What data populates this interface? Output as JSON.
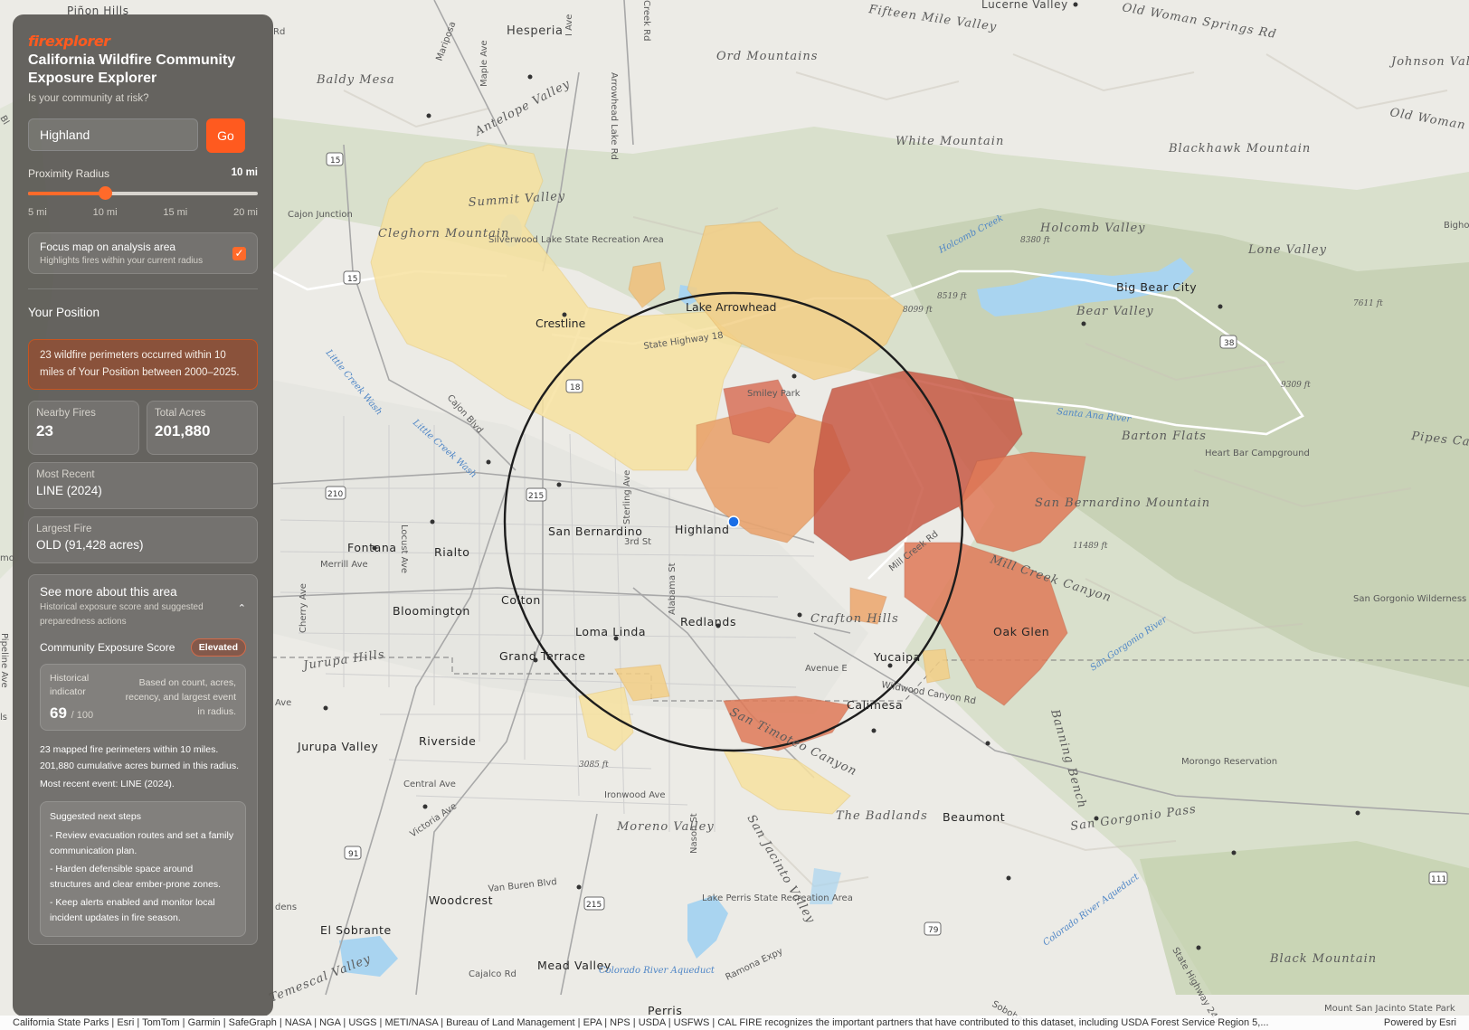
{
  "panel": {
    "logo": "firexplorer",
    "title": "California Wildfire Community Exposure Explorer",
    "subtitle": "Is your community at risk?",
    "search": {
      "value": "Highland",
      "go_label": "Go"
    },
    "radius": {
      "label": "Proximity Radius",
      "value_label": "10 mi",
      "value": 10,
      "min": 5,
      "max": 20,
      "ticks": [
        "5 mi",
        "10 mi",
        "15 mi",
        "20 mi"
      ]
    },
    "focus": {
      "label": "Focus map on analysis area",
      "hint": "Highlights fires within your current radius",
      "checked": true
    },
    "position_title": "Your Position",
    "alert": "23 wildfire perimeters occurred within 10 miles of Your Position between 2000–2025.",
    "nearby": {
      "label": "Nearby Fires",
      "value": "23"
    },
    "acres": {
      "label": "Total Acres",
      "value": "201,880"
    },
    "recent": {
      "label": "Most Recent",
      "value": "LINE (2024)"
    },
    "largest": {
      "label": "Largest Fire",
      "value": "OLD (91,428 acres)"
    },
    "more": {
      "title": "See more about this area",
      "desc": "Historical exposure score and suggested preparedness actions",
      "score_label": "Community Exposure Score",
      "score_badge": "Elevated",
      "indicator_label": "Historical indicator",
      "indicator_value": "69",
      "indicator_max": "/ 100",
      "indicator_note": "Based on count, acres, recency, and largest event in radius.",
      "line1": "23 mapped fire perimeters within 10 miles.",
      "line2": "201,880 cumulative acres burned in this radius.",
      "line3": "Most recent event: LINE (2024).",
      "steps_title": "Suggested next steps",
      "steps": [
        "- Review evacuation routes and set a family communication plan.",
        "- Harden defensible space around structures and clear ember-prone zones.",
        "- Keep alerts enabled and monitor local incident updates in fire season."
      ]
    }
  },
  "map": {
    "labels": {
      "hesperia": "Hesperia",
      "lucerne_valley": "Lucerne Valley",
      "fifteen_mile": "Fifteen Mile Valley",
      "ord_mountains": "Ord Mountains",
      "johnson_valley": "Johnson Valley",
      "old_woman_springs": "Old Woman Springs Rd",
      "old_woman_springs2": "Old Woman Sprin",
      "baldy_mesa": "Baldy Mesa",
      "antelope_valley": "Antelope Valley",
      "white_mountain": "White Mountain",
      "blackhawk": "Blackhawk Mountain",
      "summit_valley": "Summit Valley",
      "cajon_junction": "Cajon Junction",
      "cleghorn": "Cleghorn Mountain",
      "silverwood": "Silverwood Lake State Recreation Area",
      "holcomb_creek": "Holcomb Creek",
      "holcomb_valley": "Holcomb Valley",
      "elev_8380": "8380 ft",
      "lone_valley": "Lone Valley",
      "bighorn": "Bigho W",
      "big_bear_city": "Big Bear City",
      "bear_valley": "Bear Valley",
      "elev_8519": "8519 ft",
      "elev_8099": "8099 ft",
      "elev_7611": "7611 ft",
      "lake_arrowhead": "Lake Arrowhead",
      "crestline": "Crestline",
      "state_hwy_18": "State Highway 18",
      "smiley_park": "Smiley Park",
      "elev_9309": "9309 ft",
      "santa_ana_river": "Santa Ana River",
      "barton_flats": "Barton Flats",
      "heart_bar": "Heart Bar Campground",
      "pipes_canyon": "Pipes Can",
      "little_creek": "Little Creek Wash",
      "cajon_blvd": "Cajon Blvd",
      "san_bernardino": "San Bernardino",
      "sterling": "Sterling Ave",
      "highland": "Highland",
      "third_st": "3rd St",
      "fontana": "Fontana",
      "rialto": "Rialto",
      "merrill": "Merrill Ave",
      "locust": "Locust Ave",
      "sb_mountain": "San Bernardino Mountain",
      "elev_11489": "11489 ft",
      "mill_creek_rd": "Mill Creek Rd",
      "mill_creek_canyon": "Mill Creek Canyon",
      "san_gorgonio_wild": "San Gorgonio Wilderness",
      "colton": "Colton",
      "bloomington": "Bloomington",
      "alabama": "Alabama St",
      "redlands": "Redlands",
      "crafton": "Crafton Hills",
      "cherry": "Cherry Ave",
      "loma_linda": "Loma Linda",
      "oak_glen": "Oak Glen",
      "jurupa_hills": "Jurupa Hills",
      "grand_terrace": "Grand Terrace",
      "yucaipa": "Yucaipa",
      "avenue_e": "Avenue E",
      "wildwood": "Wildwood Canyon Rd",
      "san_gorgonio_river": "San Gorgonio River",
      "calimesa": "Calimesa",
      "san_timoteo": "San Timoteo Canyon",
      "banning_bench": "Banning Bench",
      "jurupa_valley": "Jurupa Valley",
      "riverside": "Riverside",
      "morongo": "Morongo Reservation",
      "elev_3085": "3085 ft",
      "central_ave": "Central Ave",
      "ironwood": "Ironwood Ave",
      "the_badlands": "The Badlands",
      "beaumont": "Beaumont",
      "san_gorgonio_pass": "San Gorgonio Pass",
      "victoria": "Victoria Ave",
      "moreno_valley": "Moreno Valley",
      "nason": "Nason St",
      "san_jacinto_valley": "San Jacinto Valley",
      "woodcrest": "Woodcrest",
      "van_buren": "Van Buren Blvd",
      "lake_perris": "Lake Perris State Recreation Area",
      "colorado_aqueduct": "Colorado River Aqueduct",
      "el_sobrante": "El Sobrante",
      "mead_valley": "Mead Valley",
      "colorado_aqueduct2": "Colorado River Aqueduct",
      "cajalco": "Cajalco Rd",
      "ramona": "Ramona Expy",
      "black_mountain": "Black Mountain",
      "state_hwy_243": "State Highway 243",
      "temescal": "Temescal Valley",
      "perris": "Perris",
      "mount_san_jacinto": "Mount San Jacinto State Park",
      "pibos": "Piñon Hills",
      "dens": "dens",
      "mo": "mo",
      "ave": "Ave",
      "ls": "ls",
      "maple": "Maple Ave",
      "i_ave": "I Ave",
      "arrowhead_lake": "Arrowhead Lake Rd",
      "creek_rd": "Creek Rd",
      "mariposa": "Mariposa",
      "rd": "Rd",
      "soboba": "Soboba",
      "bl": "Bl",
      "pinelinc": "Pipeline Ave"
    },
    "shields": [
      "15",
      "15",
      "210",
      "215",
      "18",
      "38",
      "215",
      "91",
      "79",
      "111"
    ],
    "colors": {
      "very_old": "#f7e2a0",
      "old": "#f3cf86",
      "mid": "#e9a46f",
      "recent": "#e07a58",
      "newest": "#c85a46",
      "radius_circle": "#1d1d1d",
      "position": "#1a6ee6"
    }
  },
  "attribution": {
    "left": "California State Parks | Esri | TomTom | Garmin | SafeGraph | NASA | NGA | USGS | METI/NASA | Bureau of Land Management | EPA | NPS | USDA | USFWS | CAL FIRE recognizes the important partners that have contributed to this dataset, including USDA Forest Service Region 5,...",
    "right": "Powered by Esri"
  }
}
